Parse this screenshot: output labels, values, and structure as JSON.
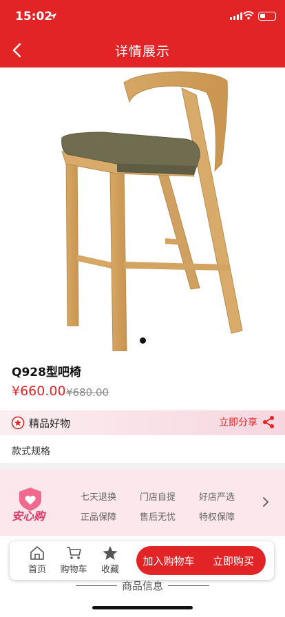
{
  "status": {
    "time": "15:02"
  },
  "nav": {
    "title": "详情展示"
  },
  "product": {
    "name": "Q928型吧椅",
    "price": "¥660.00",
    "original_price": "¥680.00"
  },
  "quality": {
    "label": "精品好物",
    "share_label": "立即分享"
  },
  "spec": {
    "label": "款式规格"
  },
  "guarantee": {
    "logo_text": "安心购",
    "items": [
      "七天退换",
      "门店自提",
      "好店严选",
      "正品保障",
      "售后无忧",
      "特权保障"
    ]
  },
  "bottom": {
    "home": "首页",
    "cart": "购物车",
    "favorite": "收藏",
    "add_to_cart": "加入购物车",
    "buy_now": "立即购买"
  },
  "section": {
    "title": "商品信息"
  },
  "colors": {
    "brand_red": "#e22426",
    "pink": "#e23a66"
  }
}
